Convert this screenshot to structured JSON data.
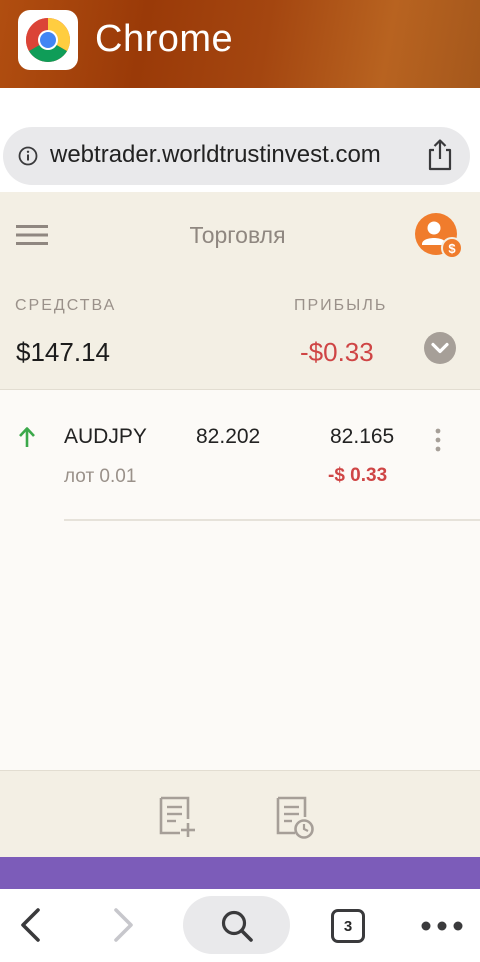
{
  "app_switcher": {
    "app_name": "Chrome",
    "icon": "chrome-logo"
  },
  "browser": {
    "url": "webtrader.worldtrustinvest.com",
    "info_icon": "info-icon",
    "share_icon": "share-icon"
  },
  "webapp": {
    "menu_icon": "hamburger-menu-icon",
    "title": "Торговля",
    "account_icon": "user-dollar-icon",
    "funds_label": "СРЕДСТВА",
    "funds_currency": "$",
    "funds_value": "147.14",
    "profit_label": "ПРИБЫЛЬ",
    "profit_sign": "-$",
    "profit_value": "0.33",
    "expand_icon": "chevron-down-circle-icon",
    "colors": {
      "accent_orange": "#f07c2c",
      "loss_red": "#cf4545",
      "gain_green": "#3ba84a",
      "panel_bg": "#f3efe4"
    },
    "trades": [
      {
        "direction": "up",
        "direction_icon": "arrow-up-icon",
        "symbol": "AUDJPY",
        "open_price": "82.202",
        "current_price": "82.165",
        "lot_text": "лот 0.01",
        "profit": "-$ 0.33"
      }
    ],
    "bottom_toolbar": {
      "new_order_icon": "new-order-icon",
      "history_icon": "order-history-icon"
    }
  },
  "browser_toolbar": {
    "back_icon": "back-arrow-icon",
    "forward_icon": "forward-arrow-icon",
    "search_icon": "search-icon",
    "tab_count": "3",
    "more_icon": "more-dots-icon"
  }
}
